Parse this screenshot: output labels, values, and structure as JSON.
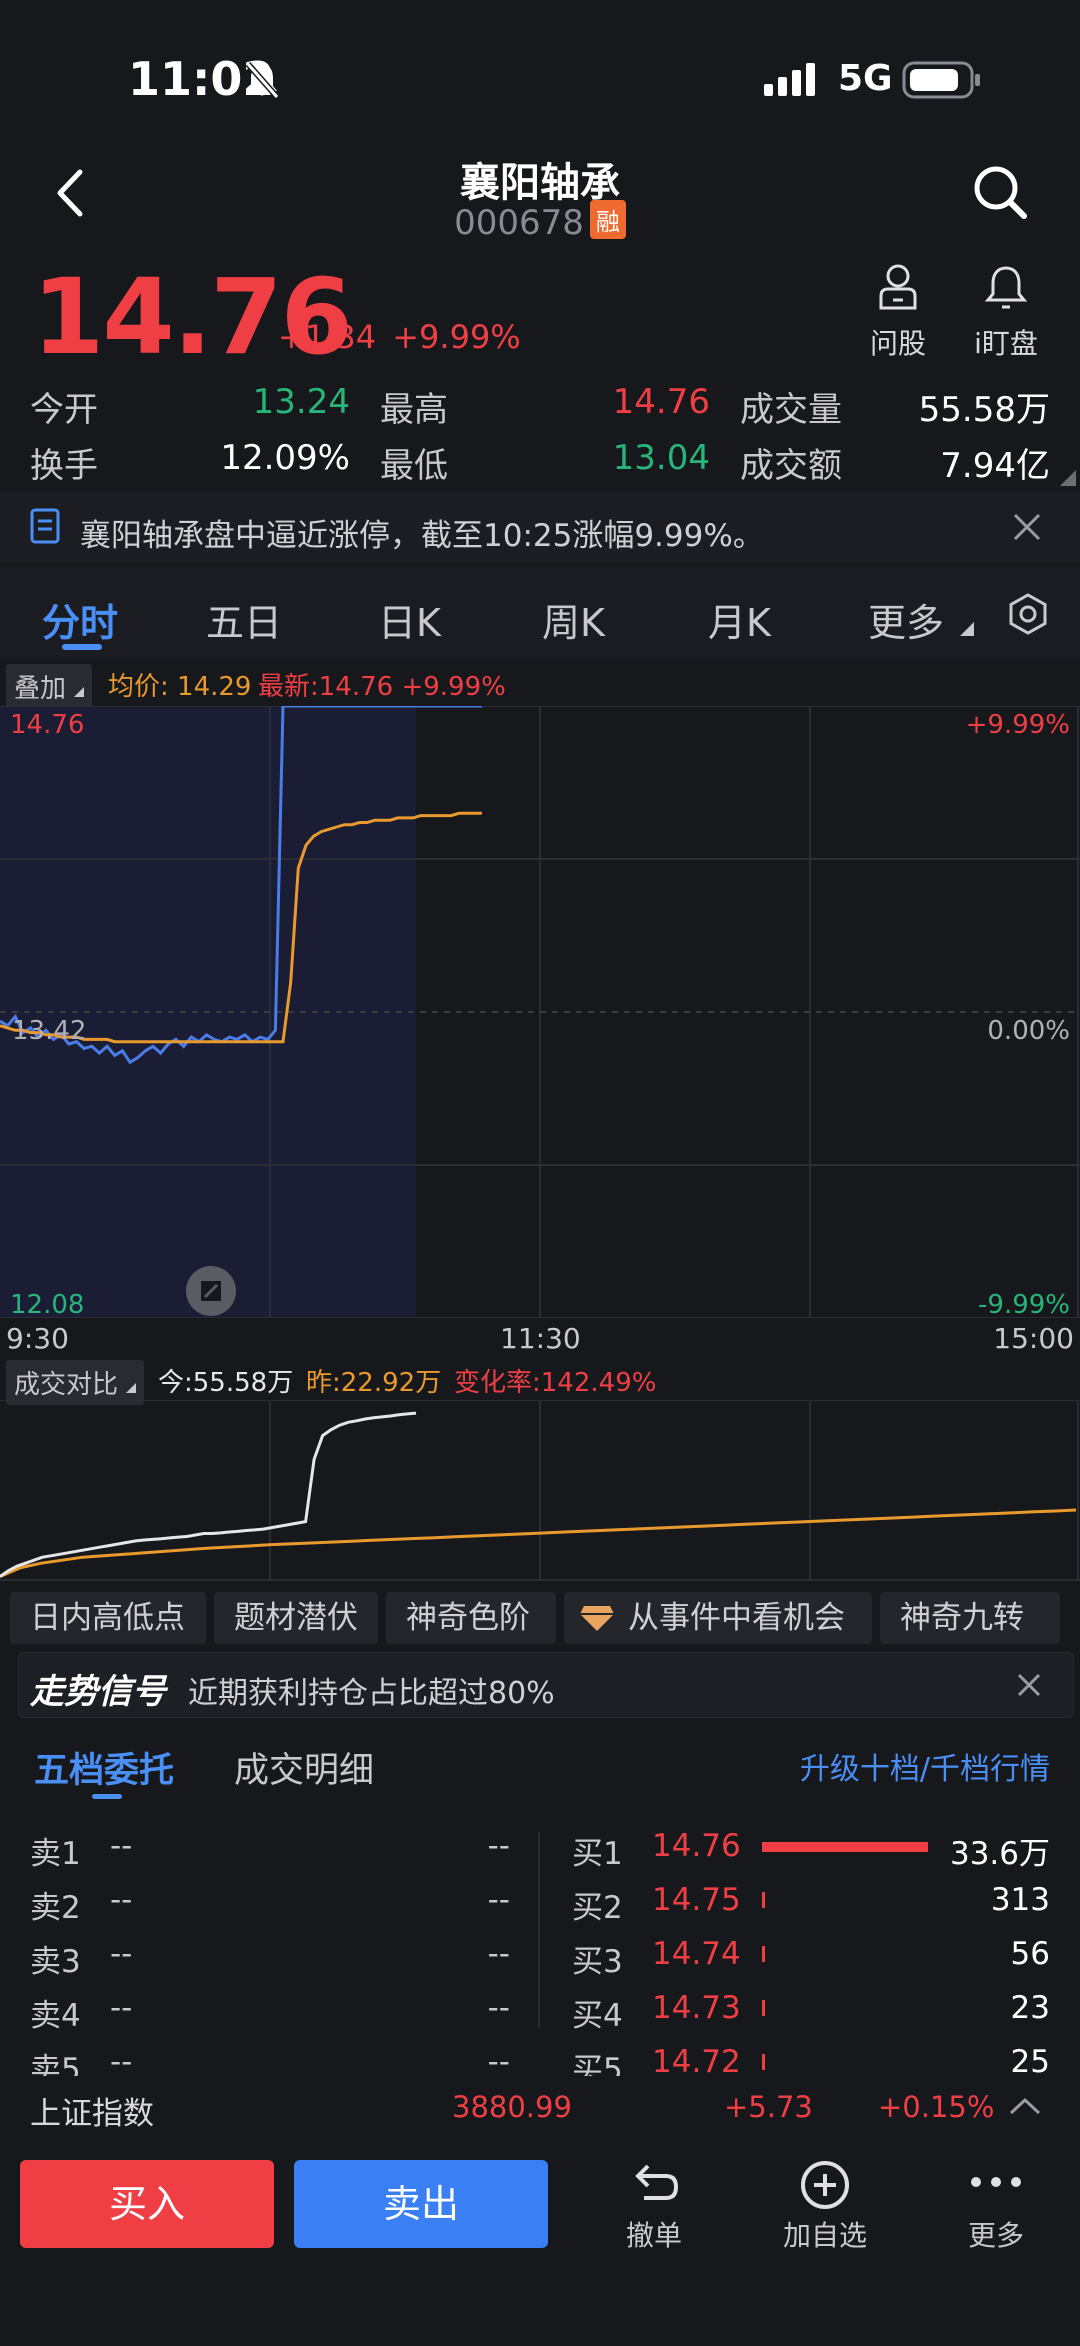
{
  "status_bar": {
    "time": "11:02",
    "network": "5G"
  },
  "header": {
    "title": "襄阳轴承",
    "code": "000678",
    "badge": "融"
  },
  "quote": {
    "price": "14.76",
    "change": "+1.34",
    "change_pct": "+9.99%",
    "actions": [
      {
        "label": "问股",
        "icon": "ask-stock-icon"
      },
      {
        "label": "i盯盘",
        "icon": "bell-icon"
      }
    ],
    "stats": [
      {
        "label": "今开",
        "value": "13.24",
        "color": "green"
      },
      {
        "label": "最高",
        "value": "14.76",
        "color": "red"
      },
      {
        "label": "成交量",
        "value": "55.58万",
        "color": "white"
      },
      {
        "label": "换手",
        "value": "12.09%",
        "color": "white"
      },
      {
        "label": "最低",
        "value": "13.04",
        "color": "green"
      },
      {
        "label": "成交额",
        "value": "7.94亿",
        "color": "white"
      }
    ]
  },
  "notice": {
    "text": "襄阳轴承盘中逼近涨停，截至10:25涨幅9.99%。"
  },
  "tabs": [
    "分时",
    "五日",
    "日K",
    "周K",
    "月K",
    "更多"
  ],
  "active_tab": "分时",
  "chart_header": {
    "overlay_label": "叠加",
    "avg_label": "均价: 14.29",
    "latest_label": "最新:14.76 +9.99%"
  },
  "chart_data": {
    "type": "line",
    "x_ticks": [
      "9:30",
      "11:30",
      "15:00"
    ],
    "y_left": {
      "top": "14.76",
      "mid": "13.42",
      "bottom": "12.08"
    },
    "y_right": {
      "top": "+9.99%",
      "mid": "0.00%",
      "bottom": "-9.99%"
    },
    "ylim": [
      12.08,
      14.76
    ],
    "series": [
      {
        "color": "#4a7de8",
        "values": [
          13.38,
          13.36,
          13.4,
          13.33,
          13.35,
          13.31,
          13.34,
          13.3,
          13.32,
          13.28,
          13.29,
          13.26,
          13.27,
          13.24,
          13.27,
          13.23,
          13.25,
          13.2,
          13.22,
          13.25,
          13.27,
          13.24,
          13.28,
          13.3,
          13.27,
          13.31,
          13.29,
          13.32,
          13.3,
          13.29,
          13.31,
          13.3,
          13.32,
          13.29,
          13.31,
          13.3,
          13.34,
          14.76,
          14.76,
          14.76,
          14.76,
          14.76,
          14.76,
          14.76,
          14.76,
          14.76,
          14.76,
          14.76,
          14.76,
          14.76,
          14.76,
          14.76,
          14.76,
          14.76,
          14.76,
          14.76,
          14.76,
          14.76,
          14.76,
          14.76,
          14.76,
          14.76,
          14.76,
          14.76
        ]
      },
      {
        "color": "#e89a2c",
        "values": [
          13.36,
          13.35,
          13.34,
          13.34,
          13.33,
          13.33,
          13.32,
          13.32,
          13.31,
          13.31,
          13.31,
          13.3,
          13.3,
          13.3,
          13.3,
          13.29,
          13.29,
          13.29,
          13.29,
          13.29,
          13.29,
          13.29,
          13.29,
          13.29,
          13.29,
          13.29,
          13.29,
          13.29,
          13.29,
          13.29,
          13.29,
          13.29,
          13.29,
          13.29,
          13.29,
          13.29,
          13.29,
          13.29,
          13.55,
          14.05,
          14.15,
          14.19,
          14.21,
          14.22,
          14.23,
          14.24,
          14.24,
          14.25,
          14.25,
          14.26,
          14.26,
          14.26,
          14.27,
          14.27,
          14.27,
          14.28,
          14.28,
          14.28,
          14.28,
          14.28,
          14.29,
          14.29,
          14.29,
          14.29
        ]
      }
    ],
    "volume_compare": {
      "label": "成交对比",
      "today_label": "今:55.58万",
      "yesterday_label": "昨:22.92万",
      "change_rate_label": "变化率:142.49%",
      "today_values": [
        0.5,
        2.5,
        4,
        5,
        6,
        7,
        7.5,
        8,
        8.5,
        9,
        9.5,
        10,
        10.5,
        11,
        11.5,
        12,
        12.5,
        12.8,
        13,
        13.2,
        13.5,
        13.8,
        14,
        14.5,
        15,
        15,
        15.2,
        15.5,
        15.7,
        16,
        16.2,
        16.5,
        17,
        17.5,
        18,
        18.5,
        19,
        40,
        48,
        50,
        51.5,
        52.5,
        53,
        53.6,
        54,
        54.3,
        54.6,
        55,
        55.3,
        55.58
      ],
      "yesterday_values": [
        0.5,
        3.5,
        5,
        6,
        7,
        7.5,
        8,
        8.5,
        9,
        9.5,
        10,
        10.4,
        10.8,
        11.2,
        11.5,
        11.8,
        12.1,
        12.4,
        12.7,
        13,
        13.3,
        13.6,
        13.9,
        14.2,
        14.5,
        14.8,
        15.1,
        15.4,
        15.7,
        16,
        16.3,
        16.6,
        16.9,
        17.2,
        17.5,
        17.8,
        18.1,
        18.4,
        18.7,
        19,
        19.3,
        19.6,
        19.9,
        20.2,
        20.5,
        20.8,
        21.1,
        21.4,
        21.7,
        22.0,
        22.3,
        22.6,
        22.92
      ],
      "ylim": [
        0,
        60
      ]
    }
  },
  "feature_chips": [
    "日内高低点",
    "题材潜伏",
    "神奇色阶",
    "从事件中看机会",
    "神奇九转"
  ],
  "signal": {
    "label": "走势信号",
    "text": "近期获利持仓占比超过80%"
  },
  "orderbook": {
    "tabs": [
      "五档委托",
      "成交明细"
    ],
    "upgrade_link": "升级十档/千档行情",
    "sells": [
      {
        "label": "卖1",
        "price": "--",
        "qty": "--"
      },
      {
        "label": "卖2",
        "price": "--",
        "qty": "--"
      },
      {
        "label": "卖3",
        "price": "--",
        "qty": "--"
      },
      {
        "label": "卖4",
        "price": "--",
        "qty": "--"
      },
      {
        "label": "卖5",
        "price": "--",
        "qty": "--"
      }
    ],
    "buys": [
      {
        "label": "买1",
        "price": "14.76",
        "qty": "33.6万",
        "share": 1.0
      },
      {
        "label": "买2",
        "price": "14.75",
        "qty": "313",
        "share": 0.01
      },
      {
        "label": "买3",
        "price": "14.74",
        "qty": "56",
        "share": 0.01
      },
      {
        "label": "买4",
        "price": "14.73",
        "qty": "23",
        "share": 0.01
      },
      {
        "label": "买5",
        "price": "14.72",
        "qty": "25",
        "share": 0.01
      }
    ]
  },
  "index_bar": {
    "name": "上证指数",
    "value": "3880.99",
    "change": "+5.73",
    "change_pct": "+0.15%"
  },
  "bottom_bar": {
    "buy_label": "买入",
    "sell_label": "卖出",
    "actions": [
      {
        "label": "撤单",
        "icon": "undo-icon"
      },
      {
        "label": "加自选",
        "icon": "add-circle-icon"
      },
      {
        "label": "更多",
        "icon": "more-dots-icon"
      }
    ]
  }
}
